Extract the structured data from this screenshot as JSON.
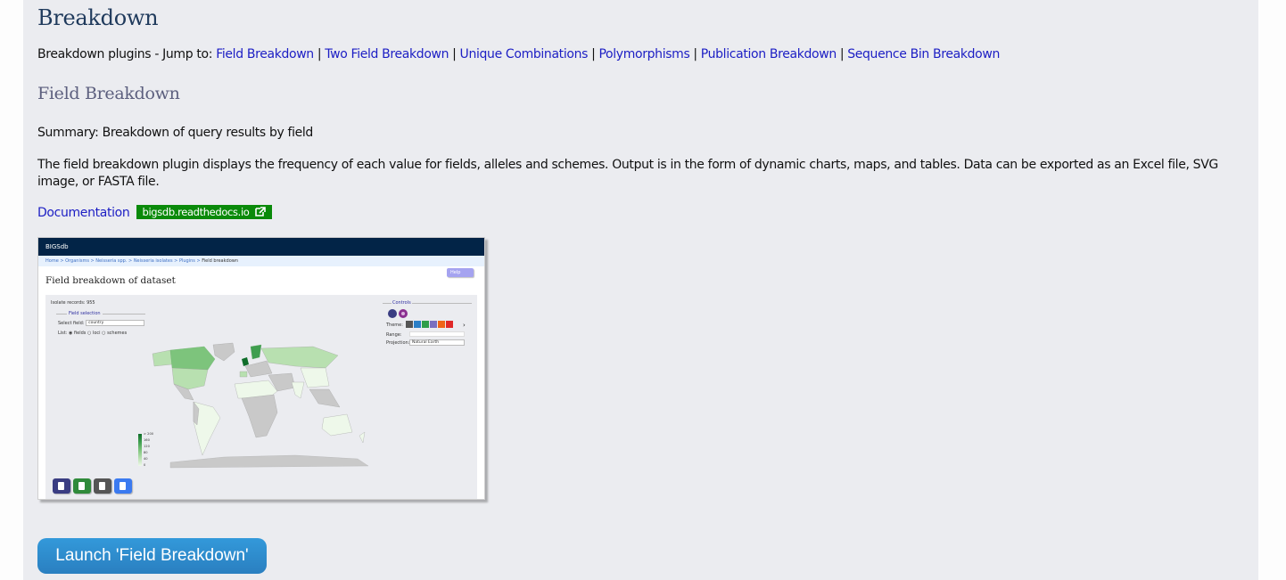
{
  "page": {
    "title": "Breakdown",
    "jump_prefix": "Breakdown plugins - Jump to:",
    "separator": "|",
    "jump_links": [
      "Field Breakdown",
      "Two Field Breakdown",
      "Unique Combinations",
      "Polymorphisms",
      "Publication Breakdown",
      "Sequence Bin Breakdown"
    ]
  },
  "plugin": {
    "heading": "Field Breakdown",
    "summary": "Summary: Breakdown of query results by field",
    "description": "The field breakdown plugin displays the frequency of each value for fields, alleles and schemes. Output is in the form of dynamic charts, maps, and tables. Data can be exported as an Excel file, SVG image, or FASTA file.",
    "documentation_label": "Documentation",
    "documentation_badge": "bigsdb.readthedocs.io",
    "launch_label": "Launch 'Field Breakdown'"
  },
  "preview": {
    "app_name": "BIGSdb",
    "breadcrumb": [
      "Home",
      "Organisms",
      "Neisseria spp.",
      "Neisseria isolates",
      "Plugins",
      "Field breakdown"
    ],
    "breadcrumb_sep": ">",
    "help_label": "Help",
    "title": "Field breakdown of dataset",
    "isolate_records": "Isolate records: 955",
    "field_selection_legend": "Field selection",
    "select_field_label": "Select field:",
    "select_field_value": "country",
    "list_label": "List:",
    "list_options": [
      "fields",
      "loci",
      "schemes"
    ],
    "controls_legend": "Controls",
    "theme_label": "Theme:",
    "theme_colors": [
      "#555555",
      "#2b7fc7",
      "#2f9e49",
      "#7a6fc0",
      "#f06418",
      "#e02828"
    ],
    "range_label": "Range:",
    "projection_label": "Projection:",
    "projection_value": "Natural Earth",
    "map_legend": [
      "> 200",
      "160",
      "120",
      "80",
      "40",
      "0"
    ],
    "export_buttons": [
      {
        "name": "table",
        "color": "#3a3d82"
      },
      {
        "name": "excel",
        "color": "#2f8a3a"
      },
      {
        "name": "text",
        "color": "#555555"
      },
      {
        "name": "fasta",
        "color": "#3b7af0"
      }
    ]
  },
  "colors": {
    "link": "#1c1ec4",
    "badge": "#0a8a0a",
    "launch_button": "#3090d2"
  }
}
